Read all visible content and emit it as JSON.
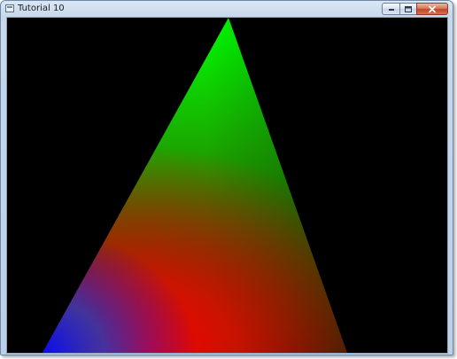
{
  "window": {
    "title": "Tutorial 10",
    "controls": {
      "minimize_icon": "minimize-icon",
      "maximize_icon": "maximize-icon",
      "close_icon": "close-icon"
    }
  },
  "canvas": {
    "background": "#000000",
    "triangle": {
      "vertex_colors": {
        "top": "#00ff00",
        "bottom_left": "#0000ff",
        "bottom_center": "#ff0000",
        "right_edge": "#004d00"
      }
    }
  }
}
